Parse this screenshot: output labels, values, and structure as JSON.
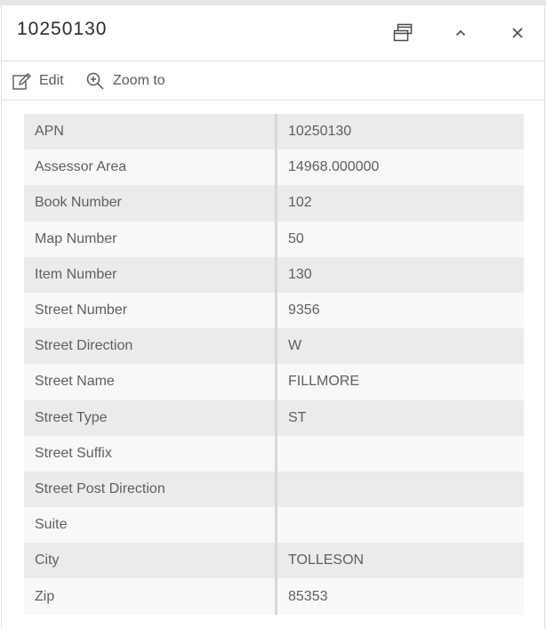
{
  "header": {
    "title": "10250130",
    "icons": {
      "dock": "dock-icon",
      "collapse": "chevron-up-icon",
      "close": "close-icon"
    }
  },
  "toolbar": {
    "edit_label": "Edit",
    "zoom_label": "Zoom to",
    "icons": {
      "edit": "edit-icon",
      "zoom": "zoom-in-icon"
    }
  },
  "attributes": [
    {
      "field": "APN",
      "value": "10250130"
    },
    {
      "field": "Assessor Area",
      "value": "14968.000000"
    },
    {
      "field": "Book Number",
      "value": "102"
    },
    {
      "field": "Map Number",
      "value": "50"
    },
    {
      "field": "Item Number",
      "value": "130"
    },
    {
      "field": "Street Number",
      "value": "9356"
    },
    {
      "field": "Street Direction",
      "value": "W"
    },
    {
      "field": "Street Name",
      "value": "FILLMORE"
    },
    {
      "field": "Street Type",
      "value": "ST"
    },
    {
      "field": "Street Suffix",
      "value": ""
    },
    {
      "field": "Street Post Direction",
      "value": ""
    },
    {
      "field": "Suite",
      "value": ""
    },
    {
      "field": "City",
      "value": "TOLLESON"
    },
    {
      "field": "Zip",
      "value": "85353"
    }
  ],
  "colors": {
    "row_odd": "#ebebeb",
    "row_even": "#f8f8f8",
    "text": "#5f5f5f",
    "title": "#2b2b2b"
  }
}
